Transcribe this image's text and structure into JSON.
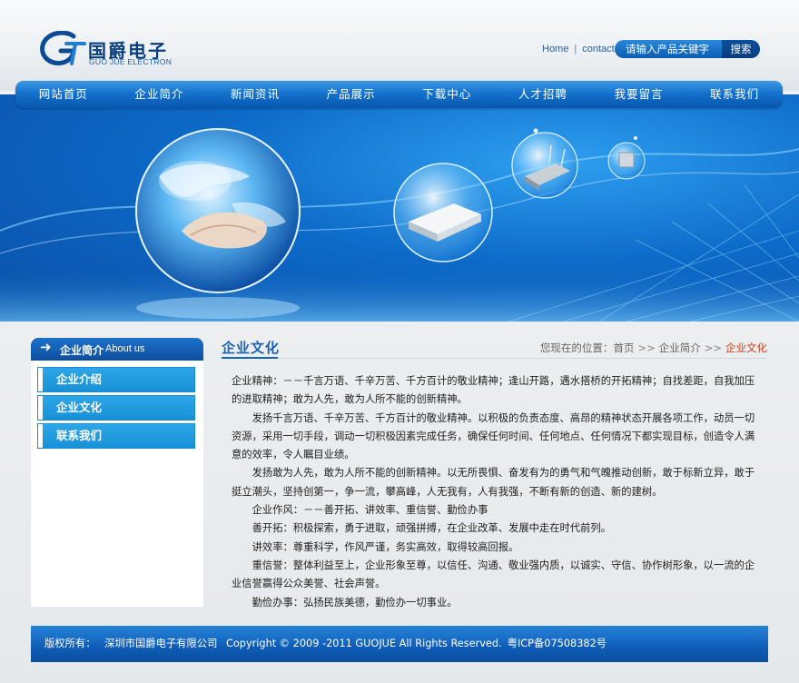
{
  "header": {
    "logo_cn": "国爵电子",
    "logo_en": "GUO JUE ELECTRON",
    "links": [
      "Home",
      "contact"
    ],
    "link_sep": "|",
    "search_placeholder": "请输入产品关键字",
    "search_button": "搜索"
  },
  "nav": {
    "items": [
      "网站首页",
      "企业简介",
      "新闻资讯",
      "产品展示",
      "下载中心",
      "人才招聘",
      "我要留言",
      "联系我们"
    ]
  },
  "sidebar": {
    "arrow": "➜",
    "title": "企业简介",
    "title_en": "About us",
    "items": [
      "企业介绍",
      "企业文化",
      "联系我们"
    ]
  },
  "content": {
    "title": "企业文化",
    "breadcrumb": {
      "prefix": "您现在的位置：",
      "items": [
        "首页",
        "企业简介",
        "企业文化"
      ],
      "sep": ">>"
    },
    "paragraphs": [
      "企业精神：－－千言万语、千辛万苦、千方百计的敬业精神；逢山开路，遇水搭桥的开拓精神；自找差距，自我加压的进取精神；敢为人先，敢为人所不能的创新精神。",
      "发扬千言万语、千辛万苦、千方百计的敬业精神。以积极的负责态度、高昂的精神状态开展各项工作，动员一切资源，采用一切手段，调动一切积极因素完成任务，确保任何时间、任何地点、任何情况下都实现目标，创造令人满意的效率，令人瞩目业绩。",
      "发扬敢为人先，敢为人所不能的创新精神。以无所畏惧、奋发有为的勇气和气魄推动创新，敢于标新立异，敢于挺立潮头，坚持创第一，争一流，攀高峰，人无我有，人有我强，不断有新的创造、新的建树。",
      "企业作风：－－善开拓、讲效率、重信誉、勤俭办事",
      "善开拓：积极探索，勇于进取，顽强拼搏，在企业改革、发展中走在时代前列。",
      "讲效率：尊重科学，作风严谨，务实高效，取得较高回报。",
      "重信誉：整体利益至上，企业形象至尊，以信任、沟通、敬业强内质，以诚实、守信、协作树形象，以一流的企业信誉赢得公众美誉、社会声誉。",
      "勤俭办事：弘扬民族美德，勤俭办一切事业。"
    ]
  },
  "footer": {
    "label": "版权所有：",
    "company": "深圳市国爵电子有限公司",
    "copyright": "Copyright © 2009 -2011 GUOJUE All Rights Reserved.",
    "icp": "粤ICP备07508382号"
  },
  "colors": {
    "primary": "#0d5fb8",
    "accent": "#1a62b5",
    "breadcrumb_current": "#d03a14"
  }
}
